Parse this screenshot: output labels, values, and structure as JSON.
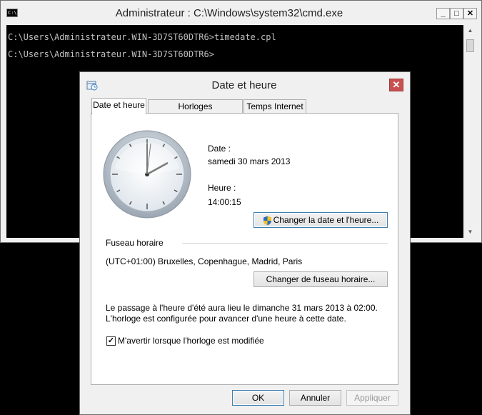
{
  "cmd": {
    "title": "Administrateur : C:\\Windows\\system32\\cmd.exe",
    "icon_text": "C:\\",
    "lines": [
      "C:\\Users\\Administrateur.WIN-3D7ST60DTR6>timedate.cpl",
      "C:\\Users\\Administrateur.WIN-3D7ST60DTR6>"
    ]
  },
  "window_buttons": {
    "minimize": "_",
    "maximize": "□",
    "close": "✕"
  },
  "dialog": {
    "title": "Date et heure",
    "close": "✕",
    "tabs": [
      "Date et heure",
      "Horloges supplémentaires",
      "Temps Internet"
    ],
    "date_label": "Date :",
    "date_value": "samedi 30 mars 2013",
    "time_label": "Heure :",
    "time_value": "14:00:15",
    "change_datetime_button": "Changer la date et l'heure...",
    "timezone_label": "Fuseau horaire",
    "timezone_value": "(UTC+01:00) Bruxelles, Copenhague, Madrid, Paris",
    "change_timezone_button": "Changer de fuseau horaire...",
    "dst_line1": "Le passage à l'heure d'été aura lieu le dimanche 31 mars 2013 à 02:00.",
    "dst_line2": "L'horloge est configurée pour avancer d'une heure à cette date.",
    "notify_checkbox_label": "M'avertir lorsque l'horloge est modifiée",
    "notify_checked": true,
    "ok_button": "OK",
    "cancel_button": "Annuler",
    "apply_button": "Appliquer"
  }
}
